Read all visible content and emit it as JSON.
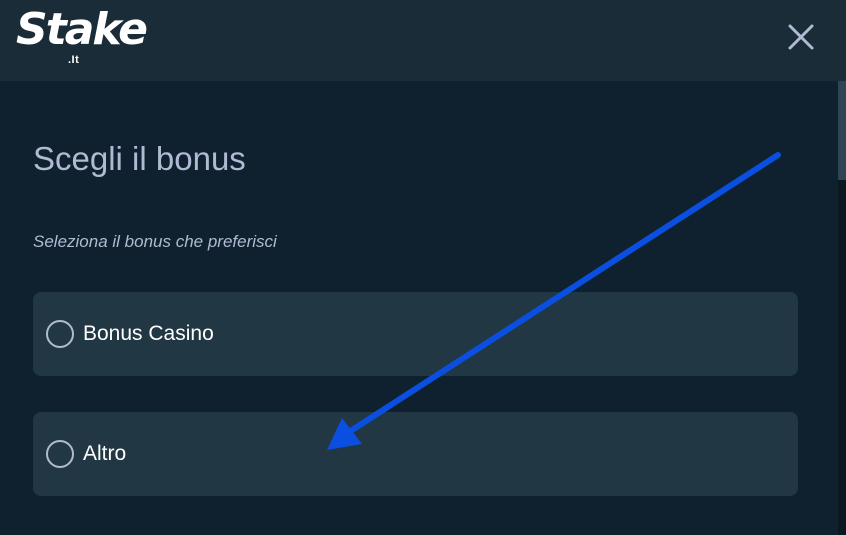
{
  "header": {
    "logo_text": "Stake",
    "logo_sub": ".It",
    "close_icon": "close-icon"
  },
  "modal": {
    "title": "Scegli il bonus",
    "subtitle": "Seleziona il bonus che preferisci",
    "options": [
      {
        "label": "Bonus Casino",
        "selected": false
      },
      {
        "label": "Altro",
        "selected": false
      }
    ]
  },
  "colors": {
    "header_bg": "#1a2c38",
    "page_bg": "#0f212e",
    "option_bg": "#213743",
    "text_muted": "#b1bad3",
    "annotation_arrow": "#0a4fe0"
  }
}
